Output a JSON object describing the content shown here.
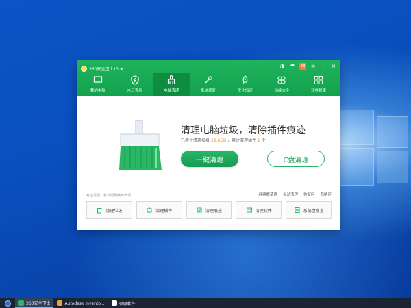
{
  "window": {
    "title": "360安全卫士13 ✦",
    "tabs": [
      {
        "label": "我的电脑",
        "icon": "monitor-icon"
      },
      {
        "label": "木马查杀",
        "icon": "shield-icon"
      },
      {
        "label": "电脑清理",
        "icon": "broom-icon",
        "active": true
      },
      {
        "label": "系统修复",
        "icon": "wrench-icon"
      },
      {
        "label": "优化加速",
        "icon": "rocket-icon"
      },
      {
        "label": "功能大全",
        "icon": "cross-icon"
      },
      {
        "label": "软件管家",
        "icon": "grid-icon"
      }
    ]
  },
  "main": {
    "headline": "清理电脑垃圾，清除插件痕迹",
    "stats_prefix": "已累计清理垃圾",
    "stats_size": "22.6GB",
    "stats_middle": "，累计清理插件",
    "stats_count": "1",
    "stats_suffix": "个",
    "primary_button": "一键清理",
    "secondary_button": "C盘清理",
    "tip": "有选清理，针对问题精准出现",
    "links": [
      "经典版清理",
      "自动清理",
      "恢复区",
      "忽略区"
    ],
    "tools": [
      {
        "label": "清理垃圾",
        "icon": "trash-icon"
      },
      {
        "label": "清理插件",
        "icon": "puzzle-icon"
      },
      {
        "label": "清理痕迹",
        "icon": "trace-icon"
      },
      {
        "label": "清理软件",
        "icon": "software-icon"
      },
      {
        "label": "系统盘瘦身",
        "icon": "disk-icon"
      }
    ]
  },
  "taskbar": {
    "items": [
      {
        "label": "360安全卫士",
        "active": true
      },
      {
        "label": "Autodesk Invento...",
        "active": false
      },
      {
        "label": "录屏软件",
        "active": false
      }
    ]
  },
  "colors": {
    "brand_green": "#13a24d",
    "accent_orange": "#f08a24"
  }
}
